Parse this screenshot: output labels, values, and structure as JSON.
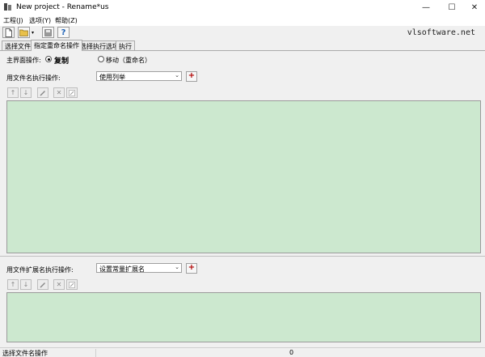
{
  "window": {
    "title": "New project - Rename*us",
    "minimize_glyph": "—",
    "maximize_glyph": "☐",
    "close_glyph": "✕"
  },
  "menu": {
    "items": [
      {
        "label": "工程(J)"
      },
      {
        "label": "选项(Y)"
      },
      {
        "label": "帮助(Z)"
      }
    ]
  },
  "toolbar": {
    "buttons": [
      {
        "name": "new-file-icon"
      },
      {
        "name": "open-folder-icon"
      },
      {
        "name": "save-icon"
      },
      {
        "name": "help-icon"
      }
    ],
    "help_glyph": "?",
    "dropdown_glyph": "▾",
    "vendor_text": "vlsoftware.net"
  },
  "tabs": [
    {
      "label": "选择文件",
      "active": false
    },
    {
      "label": "指定重命名操作",
      "active": true
    },
    {
      "label": "选择执行选项",
      "active": false
    },
    {
      "label": "执行",
      "active": false
    }
  ],
  "main_op": {
    "label": "主界面操作:",
    "options": [
      {
        "label": "复制",
        "selected": true
      },
      {
        "label": "移动（重命名）",
        "selected": false
      }
    ]
  },
  "filename_ops": {
    "label": "用文件名执行操作:",
    "combo_value": "使用列举",
    "add_glyph": "+"
  },
  "ext_ops": {
    "label": "用文件扩展名执行操作:",
    "combo_value": "设置常量扩展名",
    "add_glyph": "+"
  },
  "mini_toolbar": {
    "buttons": [
      {
        "name": "move-up-icon"
      },
      {
        "name": "move-down-icon"
      },
      {
        "name": "edit-icon"
      },
      {
        "name": "delete-icon"
      },
      {
        "name": "edit-doc-icon"
      }
    ],
    "up_glyph": "↑",
    "down_glyph": "↓",
    "delete_glyph": "✕"
  },
  "combo_arrow_glyph": "⌄",
  "statusbar": {
    "left_text": "选择文件名操作",
    "count": "0"
  },
  "colors": {
    "panel_green": "#cce8cf",
    "plus_red": "#b00000",
    "help_blue": "#1a5fb4",
    "folder_yellow": "#e8c04a"
  }
}
